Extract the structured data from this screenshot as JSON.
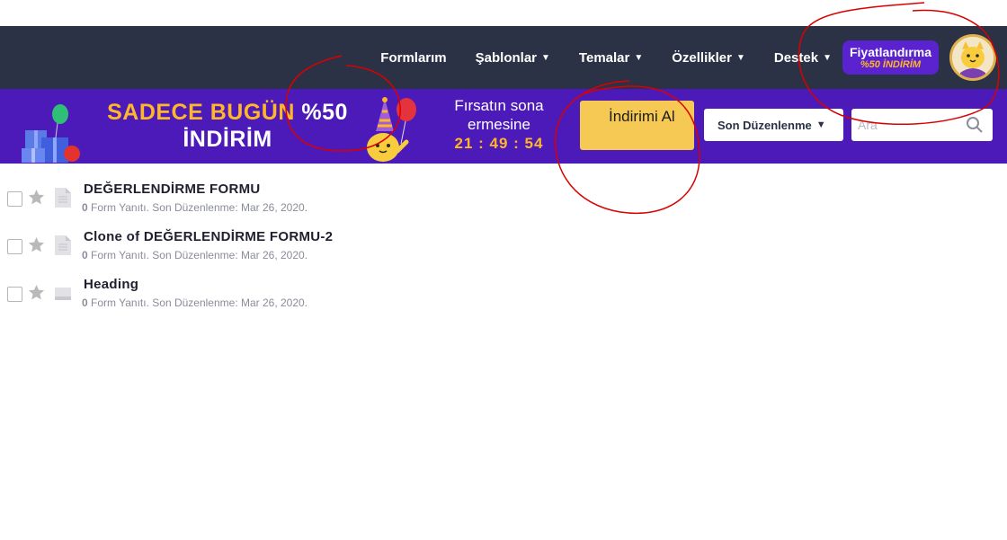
{
  "nav": {
    "items": [
      {
        "label": "Formlarım",
        "caret": ""
      },
      {
        "label": "Şablonlar",
        "caret": "▼"
      },
      {
        "label": "Temalar",
        "caret": "▼"
      },
      {
        "label": "Özellikler",
        "caret": "▼"
      },
      {
        "label": "Destek",
        "caret": "▼"
      }
    ],
    "pricing": {
      "title": "Fiyatlandırma",
      "subtitle": "%50 İNDİRİM"
    }
  },
  "banner": {
    "headline_part1": "SADECE BUGÜN ",
    "headline_percent": "%50",
    "headline_line2": "İNDİRİM",
    "countdown_label": "Fırsatın sona ermesine",
    "countdown_time": "21 : 49 : 54",
    "cta_label": "İndirimi Al",
    "sort_label": "Son Düzenlenme",
    "search_placeholder": "Ara"
  },
  "forms": [
    {
      "title": "DEĞERLENDİRME FORMU",
      "responses": "0",
      "meta": " Form Yanıtı. Son Düzenlenme: Mar 26, 2020."
    },
    {
      "title": "Clone of DEĞERLENDİRME FORMU-2",
      "responses": "0",
      "meta": " Form Yanıtı. Son Düzenlenme: Mar 26, 2020."
    },
    {
      "title": "Heading",
      "responses": "0",
      "meta": " Form Yanıtı. Son Düzenlenme: Mar 26, 2020."
    }
  ],
  "colors": {
    "nav_bg": "#2b3245",
    "banner_bg": "#4c1ab8",
    "accent_orange": "#ffb629",
    "cta_bg": "#f5c953",
    "annotation_red": "#d90000"
  },
  "icons": [
    "gifts-icon",
    "party-cat-icon",
    "cat-avatar-icon",
    "search-icon",
    "star-icon",
    "document-icon"
  ]
}
